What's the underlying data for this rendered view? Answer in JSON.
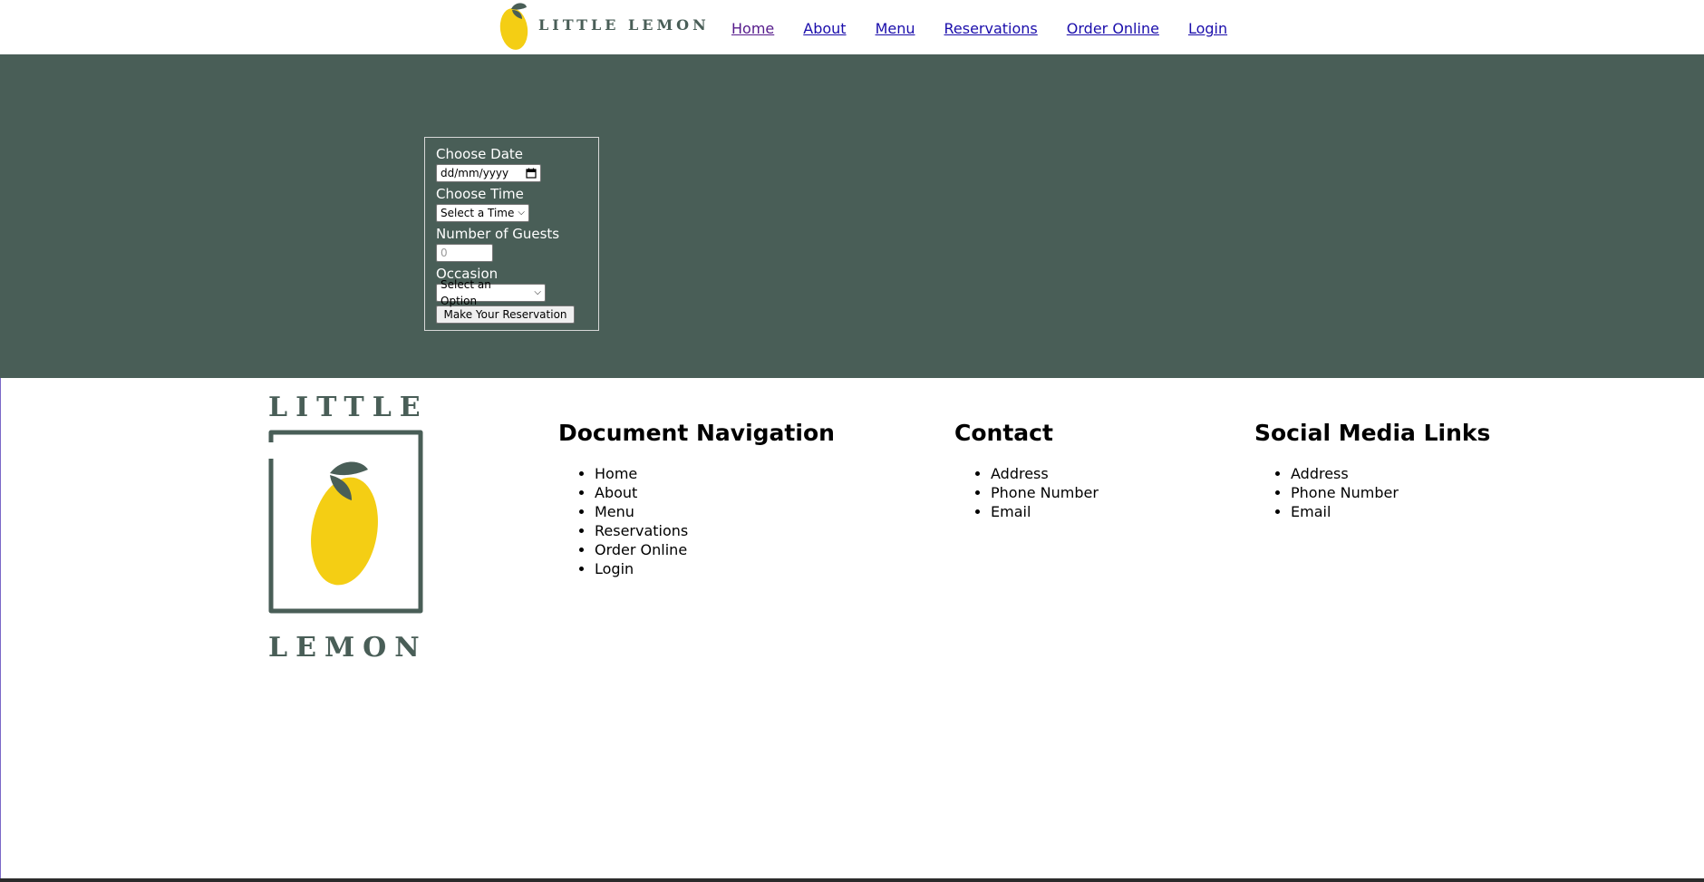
{
  "header": {
    "logo_text": "LITTLE LEMON",
    "nav": [
      {
        "label": "Home"
      },
      {
        "label": "About"
      },
      {
        "label": "Menu"
      },
      {
        "label": "Reservations"
      },
      {
        "label": "Order Online"
      },
      {
        "label": "Login"
      }
    ]
  },
  "booking_form": {
    "date_label": "Choose Date",
    "date_placeholder": "dd/mm/yyyy",
    "time_label": "Choose Time",
    "time_value": "Select a Time",
    "guests_label": "Number of Guests",
    "guests_placeholder": "0",
    "occasion_label": "Occasion",
    "occasion_value": "Select an Option",
    "submit_label": "Make Your Reservation"
  },
  "footer": {
    "logo_top": "LITTLE",
    "logo_bottom": "LEMON",
    "doc_nav": {
      "title": "Document Navigation",
      "items": [
        "Home",
        "About",
        "Menu",
        "Reservations",
        "Order Online",
        "Login"
      ]
    },
    "contact": {
      "title": "Contact",
      "items": [
        "Address",
        "Phone Number",
        "Email"
      ]
    },
    "social": {
      "title": "Social Media Links",
      "items": [
        "Address",
        "Phone Number",
        "Email"
      ]
    }
  },
  "colors": {
    "brand_green": "#495e57",
    "lemon_yellow": "#f4ce14",
    "link": "#1a0dab"
  },
  "icons": {
    "logo": "lemon-icon",
    "calendar": "calendar-icon",
    "dropdown": "chevron-down-icon"
  }
}
